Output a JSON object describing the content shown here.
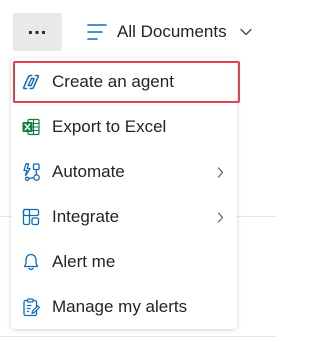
{
  "toolbar": {
    "more_label": "...",
    "view_label": "All Documents"
  },
  "menu": {
    "items": [
      {
        "label": "Create an agent",
        "icon": "copilot-agent-icon",
        "submenu": false,
        "highlighted": true
      },
      {
        "label": "Export to Excel",
        "icon": "excel-icon",
        "submenu": false
      },
      {
        "label": "Automate",
        "icon": "automate-icon",
        "submenu": true
      },
      {
        "label": "Integrate",
        "icon": "integrate-icon",
        "submenu": true
      },
      {
        "label": "Alert me",
        "icon": "bell-icon",
        "submenu": false
      },
      {
        "label": "Manage my alerts",
        "icon": "manage-alerts-icon",
        "submenu": false
      }
    ]
  },
  "colors": {
    "highlight_border": "#e0434d",
    "accent": "#0f6cbd",
    "excel_green": "#107c41",
    "text": "#242424"
  }
}
